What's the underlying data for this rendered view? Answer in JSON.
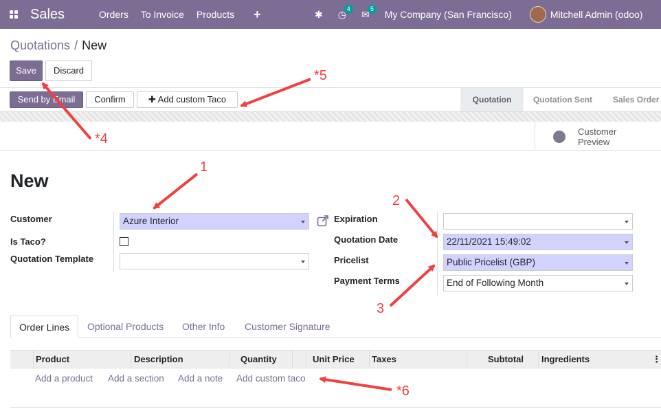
{
  "navbar": {
    "app_name": "Sales",
    "menu": [
      "Orders",
      "To Invoice",
      "Products"
    ],
    "plus": "+",
    "activity_count": "4",
    "message_count": "5",
    "company": "My Company (San Francisco)",
    "user": "Mitchell Admin (odoo)"
  },
  "breadcrumb": {
    "parent": "Quotations",
    "separator": "/",
    "current": "New"
  },
  "buttons": {
    "save": "Save",
    "discard": "Discard",
    "send_by_email": "Send by Email",
    "confirm": "Confirm",
    "add_custom_taco": "Add custom Taco"
  },
  "stages": {
    "quotation": "Quotation",
    "quotation_sent": "Quotation Sent",
    "sales_order": "Sales Order"
  },
  "smart_button": {
    "line1": "Customer",
    "line2": "Preview"
  },
  "record_title": "New",
  "form": {
    "customer_label": "Customer",
    "customer_value": "Azure Interior",
    "is_taco_label": "Is Taco?",
    "template_label": "Quotation Template",
    "template_value": "",
    "expiration_label": "Expiration",
    "expiration_value": "",
    "quotation_date_label": "Quotation Date",
    "quotation_date_value": "22/11/2021 15:49:02",
    "pricelist_label": "Pricelist",
    "pricelist_value": "Public Pricelist (GBP)",
    "payment_terms_label": "Payment Terms",
    "payment_terms_value": "End of Following Month"
  },
  "tabs": [
    "Order Lines",
    "Optional Products",
    "Other Info",
    "Customer Signature"
  ],
  "table": {
    "columns": [
      "Product",
      "Description",
      "Quantity",
      "Unit Price",
      "Taxes",
      "Subtotal",
      "Ingredients"
    ],
    "add_links": [
      "Add a product",
      "Add a section",
      "Add a note",
      "Add custom taco"
    ]
  },
  "annotations": [
    "1",
    "2",
    "3",
    "*4",
    "*5",
    "*6"
  ],
  "colors": {
    "brand": "#7c6d94",
    "required_field": "#d2d2ff",
    "annotation": "#f04040"
  }
}
